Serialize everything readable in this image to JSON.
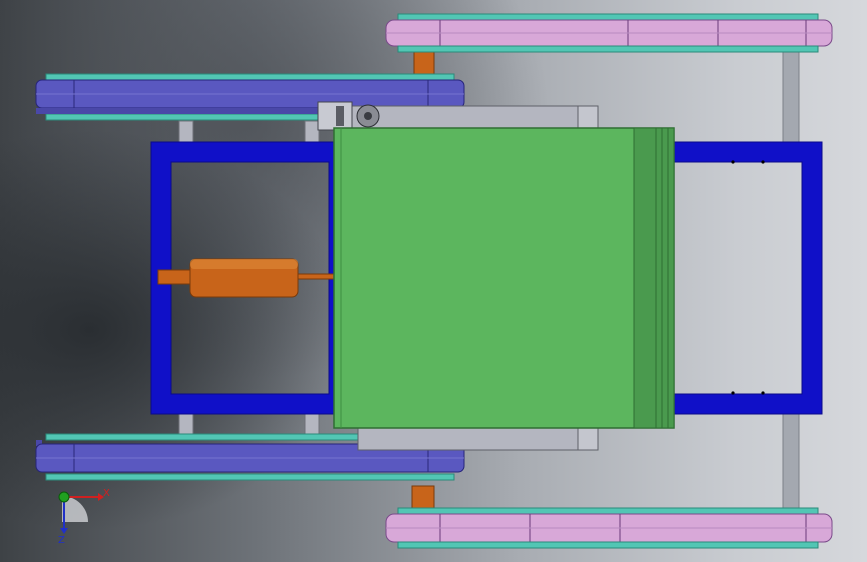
{
  "view": {
    "axis_triad": {
      "x_label": "X",
      "z_label": "Z"
    }
  },
  "colors": {
    "frame_blue": "#1010c8",
    "frame_blue_dark": "#0a0a8a",
    "battery_box_green": "#5cb65e",
    "battery_box_edge": "#3e8e42",
    "motor_orange": "#c8641a",
    "left_track_purple": "#5a58c0",
    "right_track_pink": "#d8a8d8",
    "track_edge_teal": "#52c6b4",
    "bracket_gray": "#b4b6c0",
    "shaft_gray": "#a4a8b0"
  },
  "icons": {
    "x_axis": "arrow-right-red",
    "z_axis": "arrow-down-blue",
    "origin": "green-sphere"
  }
}
